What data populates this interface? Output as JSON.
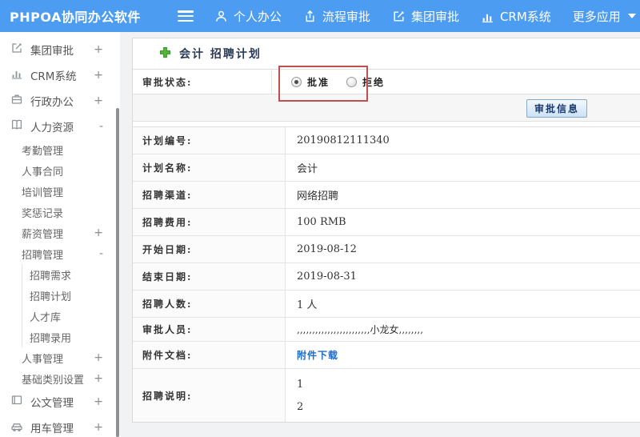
{
  "topbar": {
    "logo": "PHPOA协同办公软件",
    "nav": [
      {
        "label": "个人办公",
        "icon": "person-icon"
      },
      {
        "label": "流程审批",
        "icon": "process-icon"
      },
      {
        "label": "集团审批",
        "icon": "edit-icon"
      },
      {
        "label": "CRM系统",
        "icon": "chart-icon"
      },
      {
        "label": "更多应用",
        "icon": "caret-down-icon"
      }
    ]
  },
  "sidebar": {
    "items": [
      {
        "label": "集团审批",
        "expand": "+",
        "icon": "edit-icon"
      },
      {
        "label": "CRM系统",
        "expand": "+",
        "icon": "chart-icon"
      },
      {
        "label": "行政办公",
        "expand": "+",
        "icon": "briefcase-icon"
      },
      {
        "label": "人力资源",
        "expand": "-",
        "icon": "book-icon"
      },
      {
        "label": "考勤管理"
      },
      {
        "label": "人事合同"
      },
      {
        "label": "培训管理"
      },
      {
        "label": "奖惩记录"
      },
      {
        "label": "薪资管理",
        "expand": "+"
      },
      {
        "label": "招聘管理",
        "expand": "-"
      },
      {
        "label": "招聘需求"
      },
      {
        "label": "招聘计划"
      },
      {
        "label": "人才库"
      },
      {
        "label": "招聘录用"
      },
      {
        "label": "人事管理",
        "expand": "+"
      },
      {
        "label": "基础类别设置",
        "expand": "+"
      },
      {
        "label": "公文管理",
        "expand": "+",
        "icon": "document-icon"
      },
      {
        "label": "用车管理",
        "expand": "+",
        "icon": "car-icon"
      }
    ]
  },
  "main": {
    "title": "会计 招聘计划",
    "approval": {
      "status_label": "审批状态:",
      "options": [
        {
          "label": "批准",
          "selected": true
        },
        {
          "label": "拒绝",
          "selected": false
        }
      ],
      "button_label": "审批信息"
    },
    "fields": [
      {
        "label": "计划编号:",
        "value": "20190812111340"
      },
      {
        "label": "计划名称:",
        "value": "会计"
      },
      {
        "label": "招聘渠道:",
        "value": "网络招聘"
      },
      {
        "label": "招聘费用:",
        "value": "100 RMB"
      },
      {
        "label": "开始日期:",
        "value": "2019-08-12"
      },
      {
        "label": "结束日期:",
        "value": "2019-08-31"
      },
      {
        "label": "招聘人数:",
        "value": "1 人"
      },
      {
        "label": "审批人员:",
        "value": ",,,,,,,,,,,,,,,,,,,,,,,,小龙女,,,,,,,,"
      },
      {
        "label": "附件文档:",
        "value": "附件下载"
      },
      {
        "label": "招聘说明:",
        "lines": [
          "1",
          "2"
        ]
      }
    ]
  },
  "colors": {
    "topbar_blue": "#4c9cf2",
    "link_blue": "#1e6cc7",
    "annotation_red": "#c0504d",
    "title_navy": "#2b3a55",
    "button_face": "#cbe2f5",
    "plus_green": "#56b53e"
  }
}
